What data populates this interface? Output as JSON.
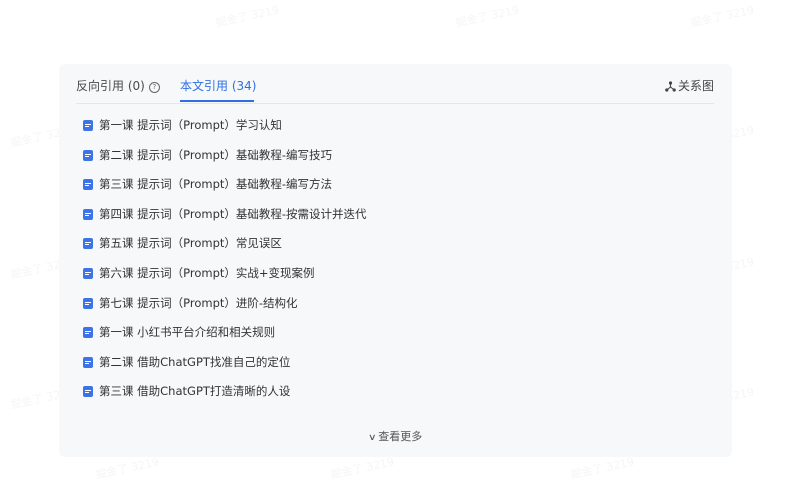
{
  "watermark": "掘金了 3219",
  "tabs": {
    "backlinks_label": "反向引用 (0)",
    "references_label": "本文引用 (34)",
    "graph_label": "关系图"
  },
  "references": [
    {
      "label": "第一课 提示词（Prompt）学习认知"
    },
    {
      "label": "第二课 提示词（Prompt）基础教程-编写技巧"
    },
    {
      "label": "第三课 提示词（Prompt）基础教程-编写方法"
    },
    {
      "label": "第四课 提示词（Prompt）基础教程-按需设计并迭代"
    },
    {
      "label": "第五课 提示词（Prompt）常见误区"
    },
    {
      "label": "第六课 提示词（Prompt）实战+变现案例"
    },
    {
      "label": "第七课 提示词（Prompt）进阶-结构化"
    },
    {
      "label": "第一课 小红书平台介绍和相关规则"
    },
    {
      "label": "第二课 借助ChatGPT找准自己的定位"
    },
    {
      "label": "第三课 借助ChatGPT打造清晰的人设"
    }
  ],
  "show_more_label": "查看更多",
  "colors": {
    "accent": "#2f6fe3",
    "doc_icon": "#3c74e8",
    "panel_bg": "#f7f8fa"
  }
}
